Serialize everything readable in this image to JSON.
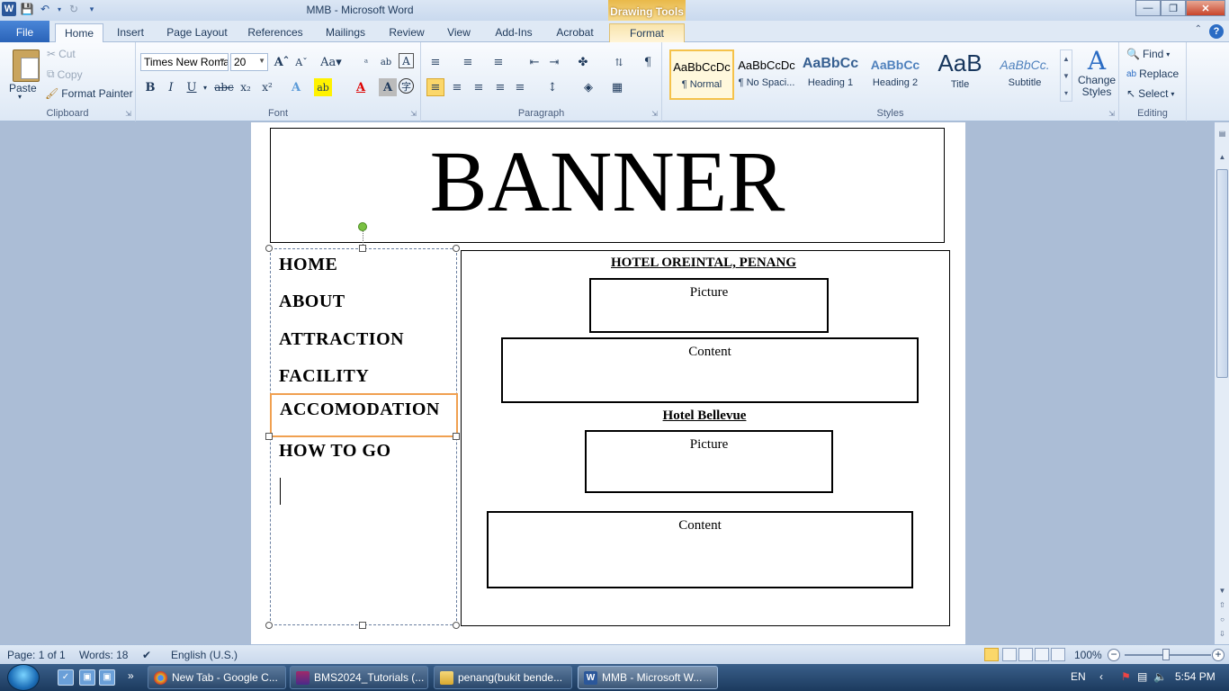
{
  "window": {
    "title": "MMB  -  Microsoft Word",
    "context_tab_head": "Drawing Tools"
  },
  "tabs": [
    "File",
    "Home",
    "Insert",
    "Page Layout",
    "References",
    "Mailings",
    "Review",
    "View",
    "Add-Ins",
    "Acrobat",
    "Format"
  ],
  "clipboard": {
    "paste": "Paste",
    "cut": "Cut",
    "copy": "Copy",
    "format_painter": "Format Painter",
    "label": "Clipboard"
  },
  "font": {
    "name": "Times New Roma",
    "size": "20",
    "label": "Font"
  },
  "paragraph": {
    "label": "Paragraph"
  },
  "styles": {
    "items": [
      {
        "sample": "AaBbCcDc",
        "name": "¶ Normal"
      },
      {
        "sample": "AaBbCcDc",
        "name": "¶ No Spaci..."
      },
      {
        "sample": "AaBbCc",
        "name": "Heading 1"
      },
      {
        "sample": "AaBbCc",
        "name": "Heading 2"
      },
      {
        "sample": "AaB",
        "name": "Title"
      },
      {
        "sample": "AaBbCc.",
        "name": "Subtitle"
      }
    ],
    "change_styles": "Change Styles",
    "label": "Styles"
  },
  "editing": {
    "find": "Find",
    "replace": "Replace",
    "select": "Select",
    "label": "Editing"
  },
  "document": {
    "banner": "BANNER",
    "nav": [
      "HOME",
      "ABOUT",
      "ATTRACTION",
      "FACILITY",
      "ACCOMODATION",
      "HOW TO GO"
    ],
    "hotel1": "HOTEL OREINTAL, PENANG",
    "hotel2": "Hotel Bellevue",
    "picture": "Picture",
    "content": "Content"
  },
  "status": {
    "page": "Page: 1 of 1",
    "words": "Words: 18",
    "language": "English (U.S.)",
    "zoom": "100%"
  },
  "taskbar": {
    "tasks": [
      "New Tab - Google C...",
      "BMS2024_Tutorials (...",
      "penang(bukit bende...",
      "MMB - Microsoft W..."
    ],
    "lang": "EN",
    "time": "5:54 PM"
  }
}
